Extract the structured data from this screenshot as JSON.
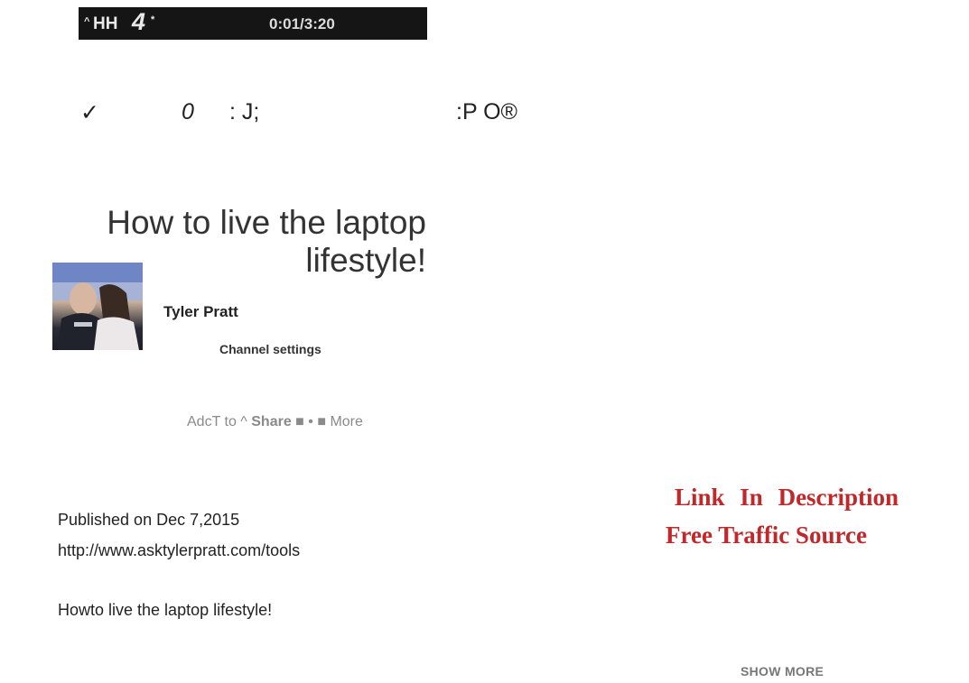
{
  "player": {
    "caret": "^",
    "label": "HH",
    "volume_glyph": "4",
    "volume_mark": "*",
    "time": "0:01/3:20"
  },
  "action_strip": {
    "check": "✓",
    "count": "0",
    "mid": ": J;",
    "right": ":P O®"
  },
  "video": {
    "title_line1": "How to live the laptop",
    "title_line2": "lifestyle!"
  },
  "owner": {
    "name": "Tyler Pratt",
    "settings_label": "Channel settings"
  },
  "actions": {
    "add_to": "AdcT to ^",
    "share": "Share",
    "sep": "■ • ■",
    "more": "More"
  },
  "description": {
    "published": "Published on Dec 7,2015",
    "link": "http://www.asktylerpratt.com/tools",
    "text": "Howto live the laptop lifestyle!",
    "show_more": "SHOW MORE"
  },
  "promo": {
    "line1": "Link In Description",
    "line2": "Free Traffic Source",
    "color": "#c0282a"
  }
}
